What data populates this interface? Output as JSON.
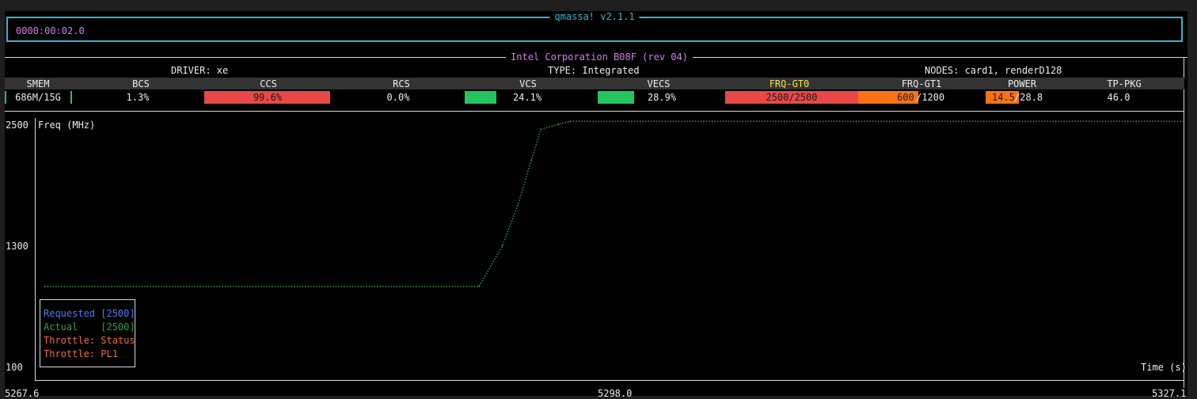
{
  "app": {
    "title": "qmassa! v2.1.1",
    "elapsed": "0000:00:02.0"
  },
  "device": {
    "name": "Intel Corporation B08F (rev 04)",
    "driver": "DRIVER: xe",
    "type": "TYPE: Integrated",
    "nodes": "NODES: card1, renderD128"
  },
  "stats": {
    "smem": {
      "header": "SMEM",
      "value": "686M/15G"
    },
    "bcs": {
      "header": "BCS",
      "value": "1.3%"
    },
    "ccs": {
      "header": "CCS",
      "value": "99.6%",
      "fill": 0.996,
      "color": "#e84848"
    },
    "rcs": {
      "header": "RCS",
      "value": "0.0%"
    },
    "vcs": {
      "header": "VCS",
      "value": "24.1%",
      "fill": 0.241,
      "color": "#22c55e"
    },
    "vecs": {
      "header": "VECS",
      "value": "28.9%",
      "fill": 0.289,
      "color": "#22c55e"
    },
    "frq0": {
      "header": "FRQ-GT0",
      "value": "2500/2500",
      "fill": 1.0,
      "color": "#e84848",
      "header_color": "#f5e642"
    },
    "frq1": {
      "header": "FRQ-GT1",
      "cur": "600",
      "max": "/1200",
      "fill": 0.5,
      "color": "#f97316"
    },
    "power": {
      "header": "POWER",
      "cur": "14.5",
      "max": "/28.8",
      "fill": 0.5,
      "color": "#f97316"
    },
    "tppkg": {
      "header": "TP-PKG",
      "value": "46.0"
    }
  },
  "chart_data": {
    "type": "line",
    "ylabel": "Freq (MHz)",
    "xlabel": "Time (s)",
    "yticks": [
      "2500",
      "1300",
      "100"
    ],
    "xticks": [
      "5267.6",
      "5298.0",
      "5327.1"
    ],
    "ylim": [
      100,
      2500
    ],
    "xlim": [
      5267.6,
      5327.1
    ],
    "series": [
      {
        "name": "Actual",
        "color": "#2ea043",
        "x": [
          5268.1,
          5290.6,
          5291.8,
          5292.6,
          5293.3,
          5293.8,
          5294.7,
          5295.3,
          5327.1
        ],
        "y": [
          900,
          900,
          1300,
          1700,
          2150,
          2450,
          2500,
          2530,
          2530
        ]
      }
    ],
    "legend": {
      "requested": "Requested [2500]",
      "actual": "Actual    [2500]",
      "throttle_status": "Throttle: Status",
      "throttle_pl1": "Throttle: PL1",
      "requested_color": "#4f7cf5",
      "actual_color": "#2ea043",
      "throttle_color": "#f06a3e"
    }
  }
}
